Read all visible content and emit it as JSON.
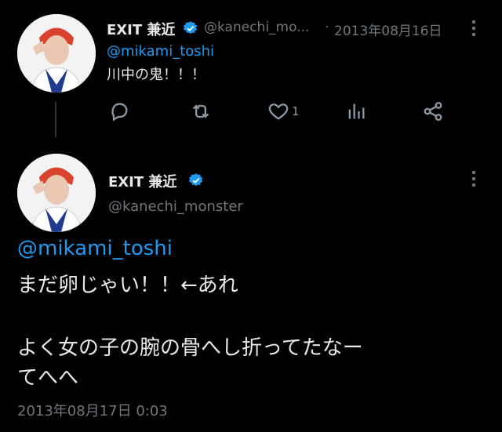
{
  "tweet1": {
    "display_name": "EXIT 兼近",
    "handle": "@kanechi_mo...",
    "separator": "·",
    "date": "2013年08月16日",
    "mention": "@mikami_toshi",
    "text": "川中の鬼！！！",
    "likes": "1"
  },
  "tweet2": {
    "display_name": "EXIT 兼近",
    "handle": "@kanechi_monster",
    "mention": "@mikami_toshi",
    "line1": "まだ卵じゃい！！←あれ",
    "line2": "よく女の子の腕の骨へし折ってたなー",
    "line3": "てへへ",
    "timestamp": "2013年08月17日 0:03"
  },
  "colors": {
    "background": "#000000",
    "text": "#e7e9ea",
    "secondary": "#71767b",
    "link": "#1d9bf0",
    "verified": "#1d9bf0"
  }
}
